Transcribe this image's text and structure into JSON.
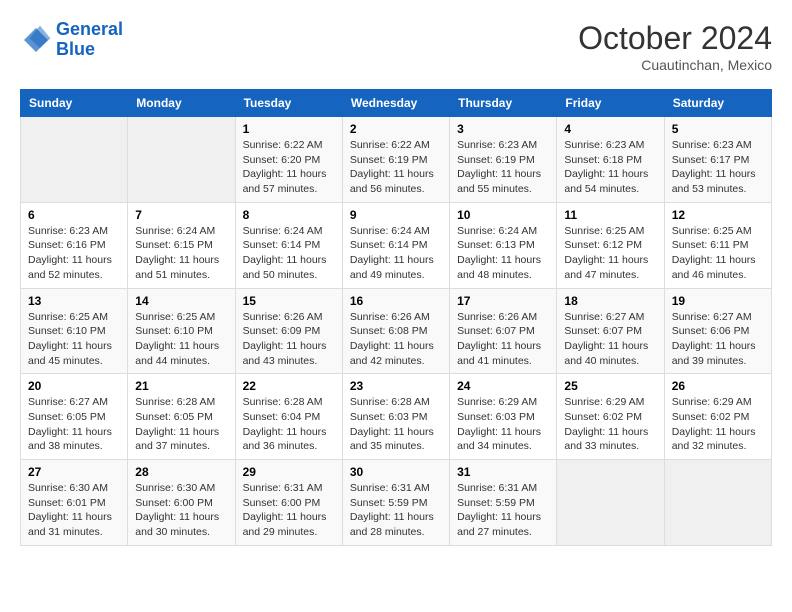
{
  "header": {
    "logo_line1": "General",
    "logo_line2": "Blue",
    "main_title": "October 2024",
    "subtitle": "Cuautinchan, Mexico"
  },
  "weekdays": [
    "Sunday",
    "Monday",
    "Tuesday",
    "Wednesday",
    "Thursday",
    "Friday",
    "Saturday"
  ],
  "weeks": [
    [
      {
        "day": "",
        "empty": true
      },
      {
        "day": "",
        "empty": true
      },
      {
        "day": "1",
        "sunrise": "Sunrise: 6:22 AM",
        "sunset": "Sunset: 6:20 PM",
        "daylight": "Daylight: 11 hours and 57 minutes."
      },
      {
        "day": "2",
        "sunrise": "Sunrise: 6:22 AM",
        "sunset": "Sunset: 6:19 PM",
        "daylight": "Daylight: 11 hours and 56 minutes."
      },
      {
        "day": "3",
        "sunrise": "Sunrise: 6:23 AM",
        "sunset": "Sunset: 6:19 PM",
        "daylight": "Daylight: 11 hours and 55 minutes."
      },
      {
        "day": "4",
        "sunrise": "Sunrise: 6:23 AM",
        "sunset": "Sunset: 6:18 PM",
        "daylight": "Daylight: 11 hours and 54 minutes."
      },
      {
        "day": "5",
        "sunrise": "Sunrise: 6:23 AM",
        "sunset": "Sunset: 6:17 PM",
        "daylight": "Daylight: 11 hours and 53 minutes."
      }
    ],
    [
      {
        "day": "6",
        "sunrise": "Sunrise: 6:23 AM",
        "sunset": "Sunset: 6:16 PM",
        "daylight": "Daylight: 11 hours and 52 minutes."
      },
      {
        "day": "7",
        "sunrise": "Sunrise: 6:24 AM",
        "sunset": "Sunset: 6:15 PM",
        "daylight": "Daylight: 11 hours and 51 minutes."
      },
      {
        "day": "8",
        "sunrise": "Sunrise: 6:24 AM",
        "sunset": "Sunset: 6:14 PM",
        "daylight": "Daylight: 11 hours and 50 minutes."
      },
      {
        "day": "9",
        "sunrise": "Sunrise: 6:24 AM",
        "sunset": "Sunset: 6:14 PM",
        "daylight": "Daylight: 11 hours and 49 minutes."
      },
      {
        "day": "10",
        "sunrise": "Sunrise: 6:24 AM",
        "sunset": "Sunset: 6:13 PM",
        "daylight": "Daylight: 11 hours and 48 minutes."
      },
      {
        "day": "11",
        "sunrise": "Sunrise: 6:25 AM",
        "sunset": "Sunset: 6:12 PM",
        "daylight": "Daylight: 11 hours and 47 minutes."
      },
      {
        "day": "12",
        "sunrise": "Sunrise: 6:25 AM",
        "sunset": "Sunset: 6:11 PM",
        "daylight": "Daylight: 11 hours and 46 minutes."
      }
    ],
    [
      {
        "day": "13",
        "sunrise": "Sunrise: 6:25 AM",
        "sunset": "Sunset: 6:10 PM",
        "daylight": "Daylight: 11 hours and 45 minutes."
      },
      {
        "day": "14",
        "sunrise": "Sunrise: 6:25 AM",
        "sunset": "Sunset: 6:10 PM",
        "daylight": "Daylight: 11 hours and 44 minutes."
      },
      {
        "day": "15",
        "sunrise": "Sunrise: 6:26 AM",
        "sunset": "Sunset: 6:09 PM",
        "daylight": "Daylight: 11 hours and 43 minutes."
      },
      {
        "day": "16",
        "sunrise": "Sunrise: 6:26 AM",
        "sunset": "Sunset: 6:08 PM",
        "daylight": "Daylight: 11 hours and 42 minutes."
      },
      {
        "day": "17",
        "sunrise": "Sunrise: 6:26 AM",
        "sunset": "Sunset: 6:07 PM",
        "daylight": "Daylight: 11 hours and 41 minutes."
      },
      {
        "day": "18",
        "sunrise": "Sunrise: 6:27 AM",
        "sunset": "Sunset: 6:07 PM",
        "daylight": "Daylight: 11 hours and 40 minutes."
      },
      {
        "day": "19",
        "sunrise": "Sunrise: 6:27 AM",
        "sunset": "Sunset: 6:06 PM",
        "daylight": "Daylight: 11 hours and 39 minutes."
      }
    ],
    [
      {
        "day": "20",
        "sunrise": "Sunrise: 6:27 AM",
        "sunset": "Sunset: 6:05 PM",
        "daylight": "Daylight: 11 hours and 38 minutes."
      },
      {
        "day": "21",
        "sunrise": "Sunrise: 6:28 AM",
        "sunset": "Sunset: 6:05 PM",
        "daylight": "Daylight: 11 hours and 37 minutes."
      },
      {
        "day": "22",
        "sunrise": "Sunrise: 6:28 AM",
        "sunset": "Sunset: 6:04 PM",
        "daylight": "Daylight: 11 hours and 36 minutes."
      },
      {
        "day": "23",
        "sunrise": "Sunrise: 6:28 AM",
        "sunset": "Sunset: 6:03 PM",
        "daylight": "Daylight: 11 hours and 35 minutes."
      },
      {
        "day": "24",
        "sunrise": "Sunrise: 6:29 AM",
        "sunset": "Sunset: 6:03 PM",
        "daylight": "Daylight: 11 hours and 34 minutes."
      },
      {
        "day": "25",
        "sunrise": "Sunrise: 6:29 AM",
        "sunset": "Sunset: 6:02 PM",
        "daylight": "Daylight: 11 hours and 33 minutes."
      },
      {
        "day": "26",
        "sunrise": "Sunrise: 6:29 AM",
        "sunset": "Sunset: 6:02 PM",
        "daylight": "Daylight: 11 hours and 32 minutes."
      }
    ],
    [
      {
        "day": "27",
        "sunrise": "Sunrise: 6:30 AM",
        "sunset": "Sunset: 6:01 PM",
        "daylight": "Daylight: 11 hours and 31 minutes."
      },
      {
        "day": "28",
        "sunrise": "Sunrise: 6:30 AM",
        "sunset": "Sunset: 6:00 PM",
        "daylight": "Daylight: 11 hours and 30 minutes."
      },
      {
        "day": "29",
        "sunrise": "Sunrise: 6:31 AM",
        "sunset": "Sunset: 6:00 PM",
        "daylight": "Daylight: 11 hours and 29 minutes."
      },
      {
        "day": "30",
        "sunrise": "Sunrise: 6:31 AM",
        "sunset": "Sunset: 5:59 PM",
        "daylight": "Daylight: 11 hours and 28 minutes."
      },
      {
        "day": "31",
        "sunrise": "Sunrise: 6:31 AM",
        "sunset": "Sunset: 5:59 PM",
        "daylight": "Daylight: 11 hours and 27 minutes."
      },
      {
        "day": "",
        "empty": true
      },
      {
        "day": "",
        "empty": true
      }
    ]
  ]
}
